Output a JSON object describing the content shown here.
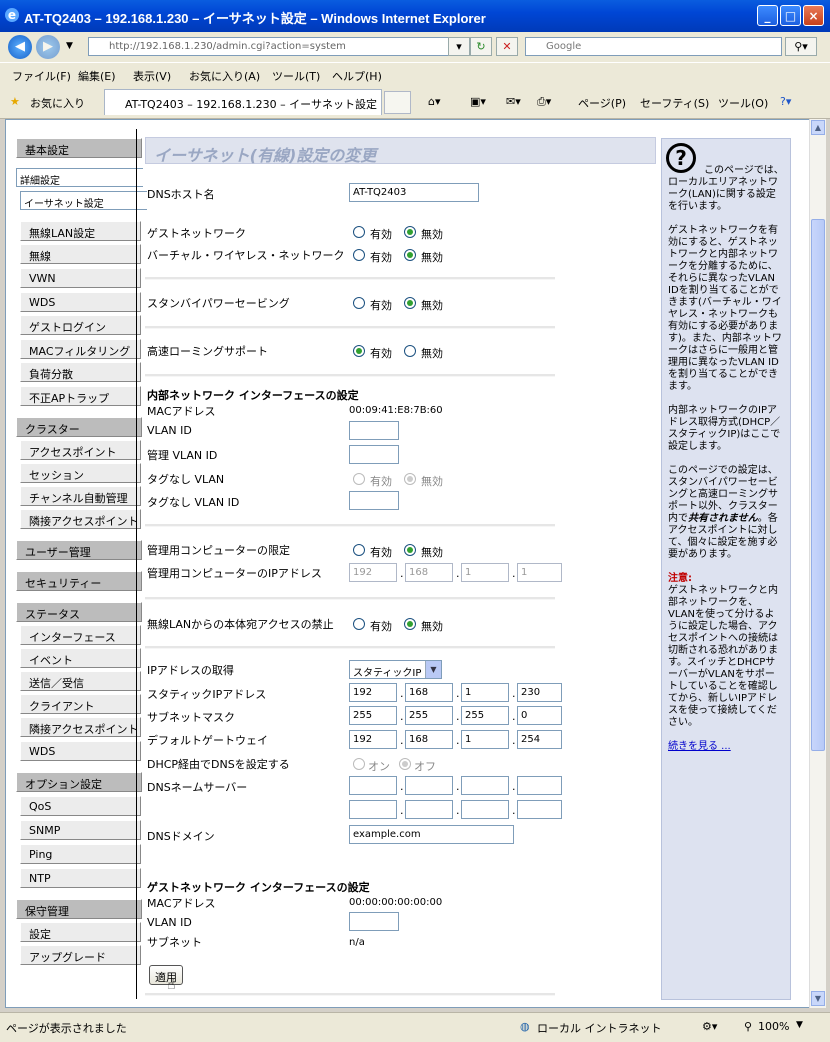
{
  "window": {
    "title": "AT-TQ2403 – 192.168.1.230 – イーサネット設定 – Windows Internet Explorer"
  },
  "browser": {
    "url": "http://192.168.1.230/admin.cgi?action=system",
    "search_placeholder": "Google",
    "menu": [
      "ファイル(F)",
      "編集(E)",
      "表示(V)",
      "お気に入り(A)",
      "ツール(T)",
      "ヘルプ(H)"
    ],
    "favorites_label": "お気に入り",
    "tab_title": "AT-TQ2403 – 192.168.1.230 – イーサネット設定",
    "toolbar": {
      "page": "ページ(P)",
      "safety": "セーフティ(S)",
      "tools": "ツール(O)"
    },
    "status": {
      "left": "ページが表示されました",
      "zone": "ローカル イントラネット",
      "zoom": "100%"
    }
  },
  "sidebar": {
    "basic": "基本設定",
    "advanced": "詳細設定",
    "advanced_items": [
      "イーサネット設定",
      "無線LAN設定",
      "無線",
      "VWN",
      "WDS",
      "ゲストログイン",
      "MACフィルタリング",
      "負荷分散",
      "不正APトラップ"
    ],
    "cluster": "クラスター",
    "cluster_items": [
      "アクセスポイント",
      "セッション",
      "チャンネル自動管理",
      "隣接アクセスポイント"
    ],
    "user_mgmt": "ユーザー管理",
    "security": "セキュリティー",
    "status": "ステータス",
    "status_items": [
      "インターフェース",
      "イベント",
      "送信／受信",
      "クライアント",
      "隣接アクセスポイント",
      "WDS"
    ],
    "options": "オプション設定",
    "option_items": [
      "QoS",
      "SNMP",
      "Ping",
      "NTP"
    ],
    "maintenance": "保守管理",
    "maintenance_items": [
      "設定",
      "アップグレード"
    ]
  },
  "main": {
    "title": "イーサネット(有線)設定の変更",
    "radio_on": "有効",
    "radio_off": "無効",
    "dns_host_label": "DNSホスト名",
    "dns_host_value": "AT-TQ2403",
    "guest_network_label": "ゲストネットワーク",
    "virtual_wireless_label": "バーチャル・ワイヤレス・ネットワーク",
    "standby_power_label": "スタンバイパワーセービング",
    "fast_roaming_label": "高速ローミングサポート",
    "internal_section": "内部ネットワーク インターフェースの設定",
    "mac_label": "MACアドレス",
    "mac_value": "00:09:41:E8:7B:60",
    "vlan_id_label": "VLAN ID",
    "mgmt_vlan_label": "管理 VLAN ID",
    "untagged_vlan_label": "タグなし VLAN",
    "untagged_vlan_id_label": "タグなし VLAN ID",
    "mgmt_pc_limit_label": "管理用コンピューターの限定",
    "mgmt_pc_ip_label": "管理用コンピューターのIPアドレス",
    "mgmt_pc_ip": [
      "192",
      "168",
      "1",
      "1"
    ],
    "wlan_access_label": "無線LANからの本体宛アクセスの禁止",
    "ip_acquire_label": "IPアドレスの取得",
    "ip_acquire_value": "スタティックIP",
    "static_ip_label": "スタティックIPアドレス",
    "static_ip": [
      "192",
      "168",
      "1",
      "230"
    ],
    "subnet_label": "サブネットマスク",
    "subnet": [
      "255",
      "255",
      "255",
      "0"
    ],
    "gateway_label": "デフォルトゲートウェイ",
    "gateway": [
      "192",
      "168",
      "1",
      "254"
    ],
    "dhcp_dns_label": "DHCP経由でDNSを設定する",
    "dhcp_on": "オン",
    "dhcp_off": "オフ",
    "dns_server_label": "DNSネームサーバー",
    "dns_domain_label": "DNSドメイン",
    "dns_domain_value": "example.com",
    "guest_section": "ゲストネットワーク インターフェースの設定",
    "guest_mac_label": "MACアドレス",
    "guest_mac_value": "00:00:00:00:00:00",
    "guest_vlan_label": "VLAN ID",
    "guest_subnet_label": "サブネット",
    "guest_subnet_value": "n/a",
    "apply_label": "適用"
  },
  "help": {
    "p1": "このページでは、ローカルエリアネットワーク(LAN)に関する設定を行います。",
    "p2": "ゲストネットワークを有効にすると、ゲストネットワークと内部ネットワークを分離するために、それらに異なったVLAN IDを割り当てることができます(バーチャル・ワイヤレス・ネットワークも有効にする必要があります)。また、内部ネットワークはさらに一般用と管理用に異なったVLAN IDを割り当てることができます。",
    "p3": "内部ネットワークのIPアドレス取得方式(DHCP／スタティックIP)はここで設定します。",
    "p4a": "このページでの設定は、スタンバイパワーセービングと高速ローミングサポート以外、クラスター内で",
    "p4b": "共有されません",
    "p4c": "。各アクセスポイントに対して、個々に設定を施す必要があります。",
    "note_title": "注意:",
    "note": "ゲストネットワークと内部ネットワークを、VLANを使って分けるように設定した場合、アクセスポイントへの接続は切断される恐れがあります。スイッチとDHCPサーバーがVLANをサポートしていることを確認してから、新しいIPアドレスを使って接続してください。",
    "more": "続きを見る ..."
  }
}
